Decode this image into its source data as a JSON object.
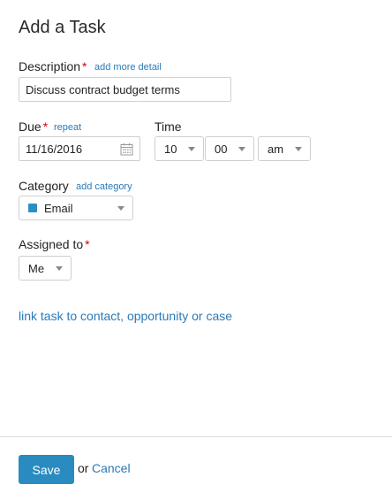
{
  "header": {
    "title": "Add a Task"
  },
  "description": {
    "label": "Description",
    "required_mark": "*",
    "more_link": "add more detail",
    "value": "Discuss contract budget terms"
  },
  "due": {
    "label": "Due",
    "required_mark": "*",
    "repeat_link": "repeat",
    "value": "11/16/2016",
    "icon": "calendar-icon"
  },
  "time": {
    "label": "Time",
    "hour": "10",
    "minute": "00",
    "ampm": "am"
  },
  "category": {
    "label": "Category",
    "add_link": "add category",
    "value": "Email",
    "swatch_color": "#2b8fc6"
  },
  "assigned": {
    "label": "Assigned to",
    "required_mark": "*",
    "value": "Me"
  },
  "link_task": "link task to contact, opportunity or case",
  "footer": {
    "save_label": "Save",
    "or_text": "or",
    "cancel_label": "Cancel"
  },
  "colors": {
    "accent": "#2a8bc0",
    "link": "#2a7ab8",
    "required": "#d0021b"
  }
}
